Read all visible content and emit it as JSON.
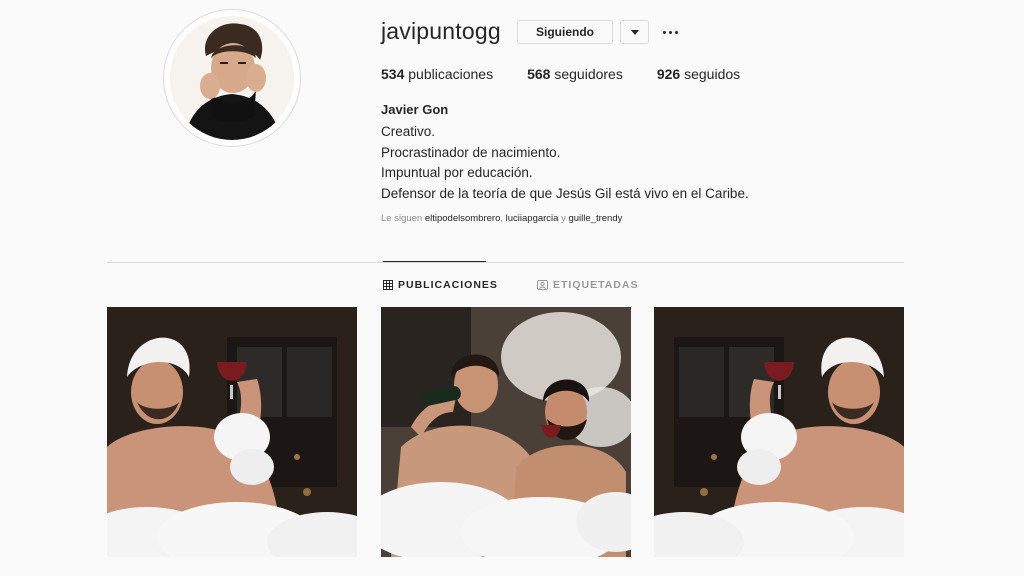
{
  "profile": {
    "username": "javipuntogg",
    "follow_label": "Siguiendo",
    "full_name": "Javier Gon",
    "bio": [
      "Creativo.",
      "Procrastinador de nacimiento.",
      "Impuntual por educación.",
      "Defensor de la teoría de que Jesús Gil está vivo en el Caribe."
    ],
    "followed_by": {
      "prefix": "Le siguen",
      "accounts": [
        "eltipodelsombrero",
        "luciiapgarcia",
        "guille_trendy"
      ],
      "separator": ", ",
      "conjunction": " y "
    }
  },
  "stats": {
    "posts_count": "534",
    "posts_label": "publicaciones",
    "followers_count": "568",
    "followers_label": "seguidores",
    "following_count": "926",
    "following_label": "seguidos"
  },
  "tabs": {
    "posts_label": "PUBLICACIONES",
    "tagged_label": "ETIQUETADAS"
  },
  "icons": {
    "dropdown": "caret-down-icon",
    "more": "more-options-icon",
    "posts_tab": "grid-icon",
    "tagged_tab": "tagged-icon"
  },
  "colors": {
    "background": "#fafafa",
    "text": "#262626",
    "muted": "#8e8e8e",
    "border": "#dbdbdb"
  }
}
